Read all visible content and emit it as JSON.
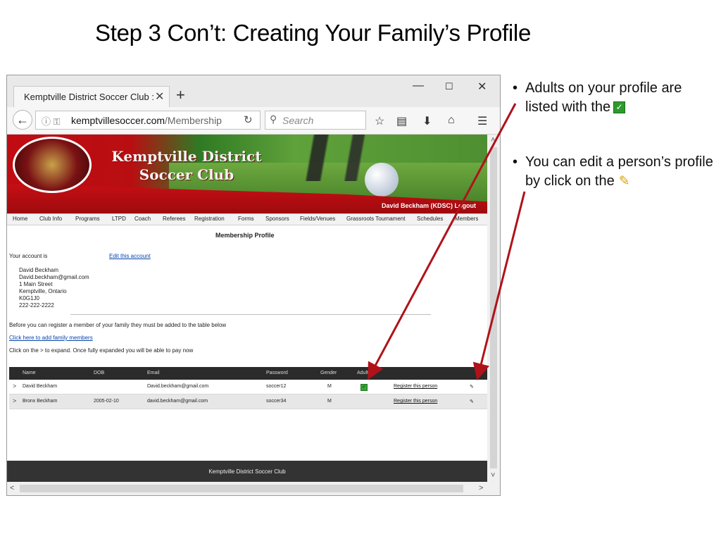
{
  "slide": {
    "title": "Step 3 Con’t: Creating Your Family’s Profile",
    "bullet1": "Adults on your profile are listed with the",
    "bullet2": "You can edit a person’s profile by click on the"
  },
  "browser": {
    "tab_title": "Kemptville District Soccer Club :",
    "url_domain": "kemptvillesoccer.com",
    "url_path": "/Membership",
    "search_placeholder": "Search"
  },
  "site": {
    "club_name_line1": "Kemptville District",
    "club_name_line2": "Soccer Club",
    "user_line": "David Beckham (KDSC)  Logout",
    "menu": [
      "Home",
      "Club Info",
      "Programs",
      "LTPD",
      "Coach",
      "Referees",
      "Registration",
      "Forms",
      "Sponsors",
      "Fields/Venues",
      "Grassroots Tournament",
      "Schedules",
      "Members"
    ],
    "page_heading": "Membership Profile",
    "account_label": "Your account is",
    "edit_account": "Edit this account",
    "account": {
      "name": "David Beckham",
      "email": "David.beckham@gmail.com",
      "street": "1 Main Street",
      "city": "Kemptville, Ontario",
      "postal": "K0G1J0",
      "phone": "222-222-2222"
    },
    "family_note": "Before you can register a member of your family they must be added to the table below",
    "add_family_link": "Click here to add family members",
    "expand_note": "Click on the > to expand. Once fully expanded you will be able to pay now",
    "table": {
      "headers": [
        "Name",
        "DOB",
        "Email",
        "Password",
        "Gender",
        "Adult"
      ],
      "rows": [
        {
          "chev": ">",
          "name": "David Beckham",
          "dob": "",
          "email": "David.beckham@gmail.com",
          "password": "soccer12",
          "gender": "M",
          "adult": true,
          "register": "Register this person"
        },
        {
          "chev": ">",
          "name": "Bronx Beckham",
          "dob": "2005-02-10",
          "email": "david.beckham@gmail.com",
          "password": "soccer34",
          "gender": "M",
          "adult": false,
          "register": "Register this person"
        }
      ]
    },
    "footer": "Kemptville District Soccer Club"
  },
  "colors": {
    "arrow": "#b0121a",
    "check": "#2e9a2e",
    "pencil": "#d9a400",
    "banner_red": "#c00b12"
  }
}
